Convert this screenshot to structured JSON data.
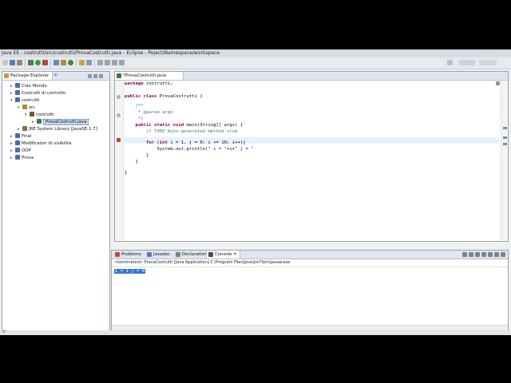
{
  "window": {
    "title": "Java EE - costrutti/src/costrutti/ProvaCostrutti.java - Eclipse - Poject/Namespace/workspace"
  },
  "toolbar": {
    "icons": [
      "new-icon",
      "save-icon",
      "print-icon",
      "debug-icon",
      "run-icon",
      "external-tools-icon",
      "new-java-project-icon",
      "new-package-icon",
      "new-class-icon",
      "open-type-icon",
      "search-icon",
      "next-annotation-icon",
      "prev-annotation-icon",
      "back-icon",
      "forward-icon",
      "perspective-icon",
      "java-ee-perspective-icon",
      "java-perspective-icon"
    ]
  },
  "package_explorer": {
    "title": "Package Explorer",
    "close": "✕",
    "tree": [
      {
        "label": "Ciao Mondo",
        "icon": "project-icon",
        "depth": 0,
        "twisty": "▸"
      },
      {
        "label": "Costrutti di controllo",
        "icon": "project-icon",
        "depth": 0,
        "twisty": "▸"
      },
      {
        "label": "costrutti",
        "icon": "project-icon",
        "depth": 0,
        "twisty": "▾"
      },
      {
        "label": "src",
        "icon": "source-folder-icon",
        "depth": 1,
        "twisty": "▾"
      },
      {
        "label": "costrutti",
        "icon": "package-icon",
        "depth": 2,
        "twisty": "▾"
      },
      {
        "label": "ProvaCostrutti.java",
        "icon": "java-file-icon",
        "depth": 3,
        "twisty": "▸",
        "selected": true
      },
      {
        "label": "JRE System Library [JavaSE-1.7]",
        "icon": "library-icon",
        "depth": 1,
        "twisty": "▸"
      },
      {
        "label": "Final",
        "icon": "project-icon",
        "depth": 0,
        "twisty": "▸"
      },
      {
        "label": "Modificatori di visibilità",
        "icon": "project-icon",
        "depth": 0,
        "twisty": "▸"
      },
      {
        "label": "OOP",
        "icon": "project-icon",
        "depth": 0,
        "twisty": "▸"
      },
      {
        "label": "Prova",
        "icon": "project-icon",
        "depth": 0,
        "twisty": "▸"
      }
    ]
  },
  "editor": {
    "tab_label": "*ProvaCostrutti.java",
    "code": {
      "l1_kw": "package",
      "l1_rest": " costrutti;",
      "l2_kw1": "public",
      "l2_kw2": " class",
      "l2_rest": " ProvaCostrutti {",
      "l3": "    /**",
      "l4_pre": "     * ",
      "l4_tag": "@param",
      "l4_rest": " args",
      "l5": "     */",
      "l6_kw1": "    public",
      "l6_kw2": " static",
      "l6_kw3": " void",
      "l6_rest": " main(String[] args) {",
      "l7": "        // TODO Auto-generated method stub",
      "l8_kw1": "        for",
      "l8_a": " (",
      "l8_kw2": "int",
      "l8_b": " i = 1, j = 0; i <= 10; i++){",
      "l9_a": "            System.",
      "l9_fld": "out",
      "l9_b": ".println(",
      "l9_s1": "\" i = \"",
      "l9_c": "+i+",
      "l9_s2": "\" j = \"",
      "l10": "        }",
      "l11": "    }",
      "l12": "}"
    }
  },
  "console": {
    "tabs": [
      {
        "label": "Problems",
        "icon": "problems-icon"
      },
      {
        "label": "Javadoc",
        "icon": "javadoc-icon"
      },
      {
        "label": "Declaration",
        "icon": "declaration-icon"
      },
      {
        "label": "Console",
        "icon": "console-icon",
        "active": true,
        "close": "✕"
      }
    ],
    "status": "<terminated> ProvaCostrutti [Java Application] C:\\Program Files\\Java\\jre7\\bin\\javaw.exe",
    "output": " i = 1 j = 0"
  },
  "statusbar": {
    "text": "0°"
  }
}
